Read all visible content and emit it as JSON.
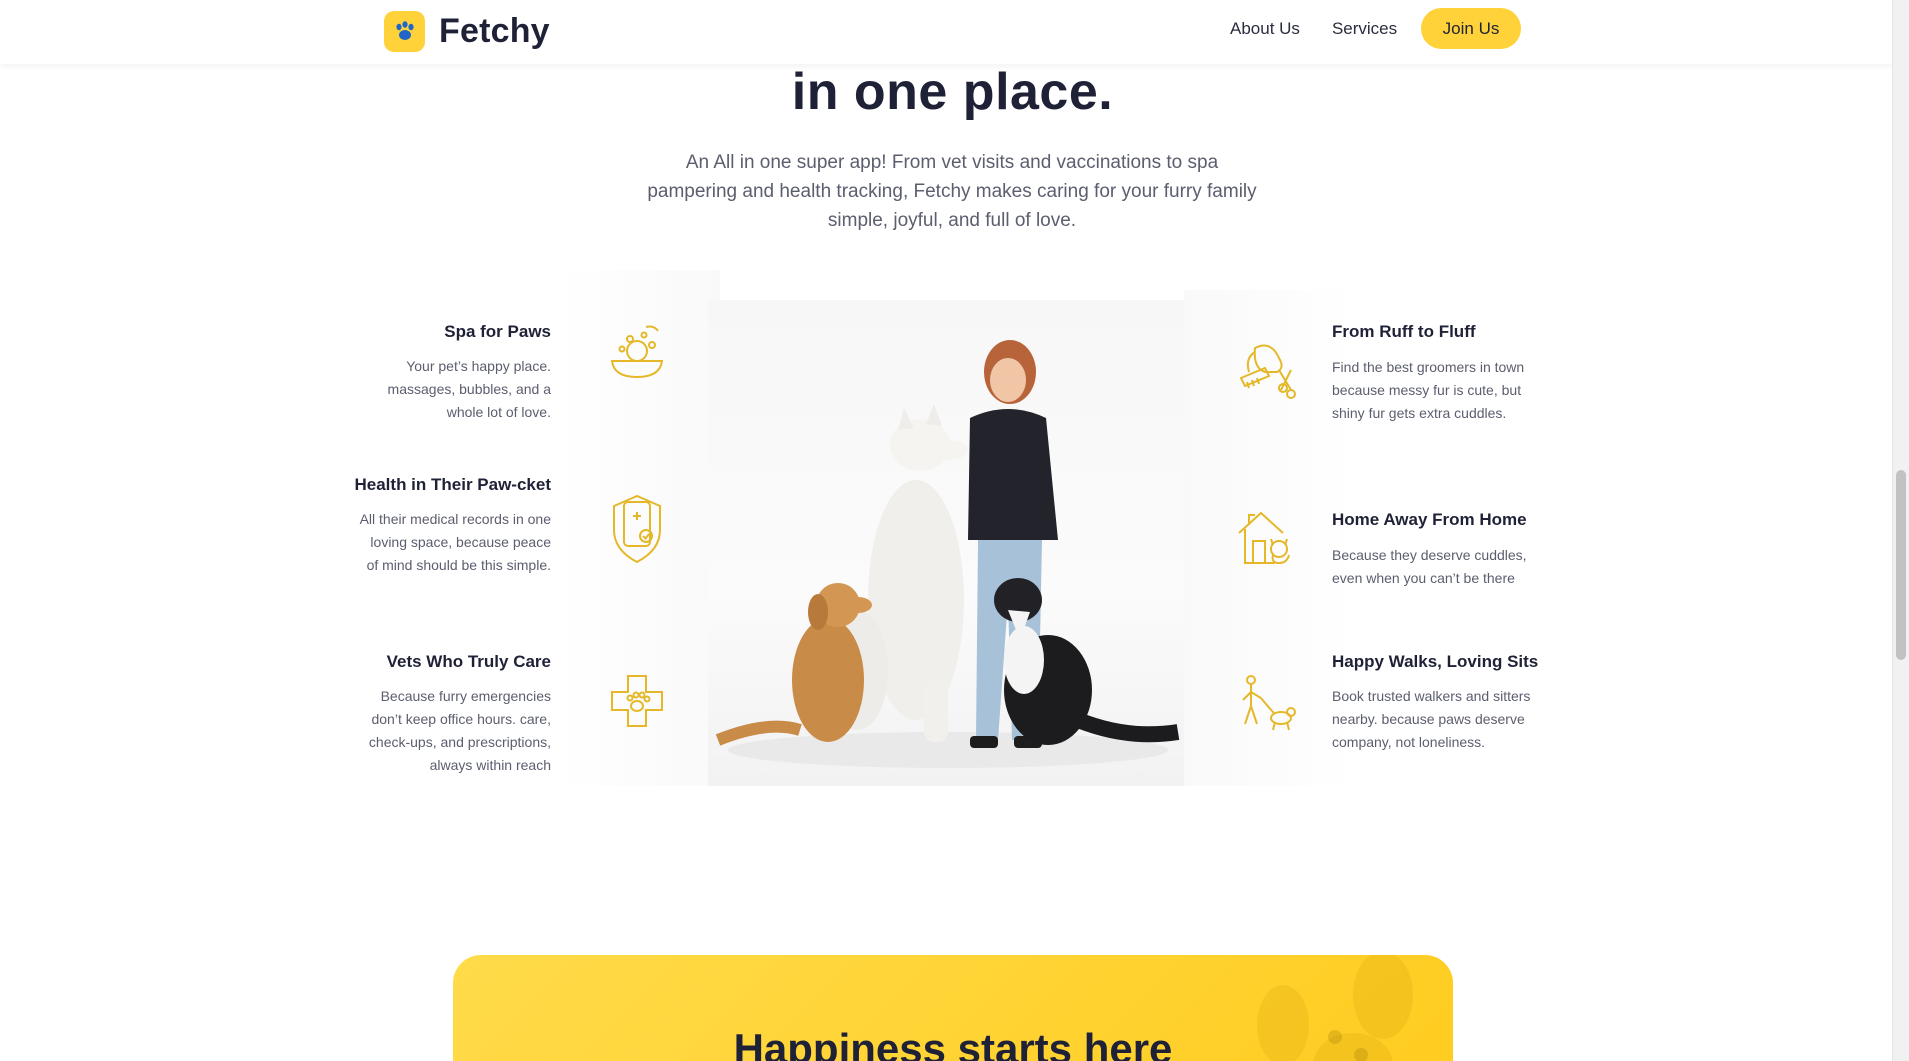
{
  "brand": {
    "name": "Fetchy",
    "logo_icon": "paw-icon",
    "accent": "#ffd23a"
  },
  "nav": {
    "about": "About Us",
    "services": "Services",
    "join": "Join Us"
  },
  "hero": {
    "title": "in one place.",
    "description": "An All in one super app! From vet visits and vaccinations to spa pampering and health tracking, Fetchy makes caring for your furry family simple, joyful, and full of love."
  },
  "features_left": [
    {
      "title": "Spa for Paws",
      "desc": "Your pet’s happy place. massages, bubbles, and a whole lot of love.",
      "icon": "bath-icon"
    },
    {
      "title": "Health in Their Paw-cket",
      "desc": "All their medical records in one loving space, because peace of mind should be this simple.",
      "icon": "medical-shield-icon"
    },
    {
      "title": "Vets Who Truly Care",
      "desc": "Because furry emergencies don’t keep office hours. care, check-ups, and prescriptions, always within reach",
      "icon": "vet-cross-icon"
    }
  ],
  "features_right": [
    {
      "title": "From Ruff to Fluff",
      "desc": "Find the best groomers in town because messy fur is cute, but shiny fur gets extra cuddles.",
      "icon": "grooming-icon"
    },
    {
      "title": "Home Away From Home",
      "desc": "Because they deserve cuddles, even when you can’t be there",
      "icon": "pet-hotel-icon"
    },
    {
      "title": "Happy Walks, Loving Sits",
      "desc": "Book trusted walkers and sitters nearby. because paws deserve company, not loneliness.",
      "icon": "dog-walker-icon"
    }
  ],
  "cta": {
    "title": "Happiness starts here"
  }
}
